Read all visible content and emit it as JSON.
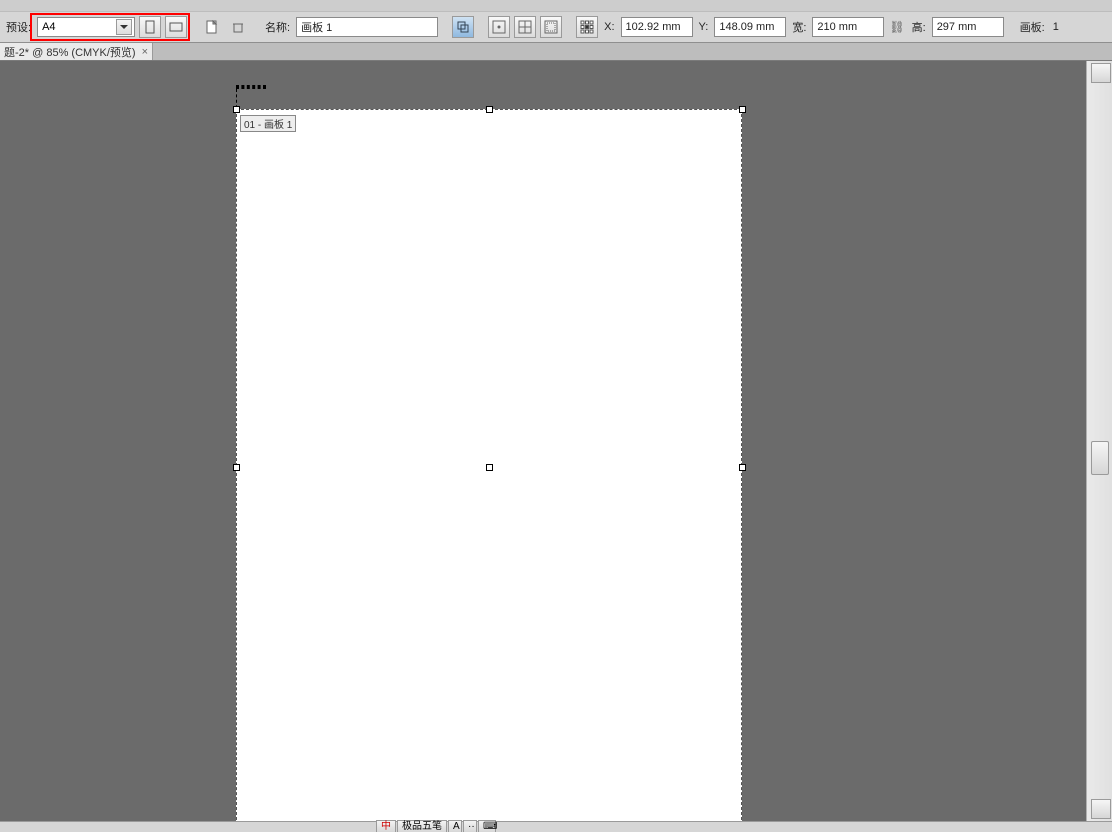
{
  "toolbar": {
    "preset_label": "预设:",
    "preset_value": "A4",
    "name_label": "名称:",
    "name_value": "画板 1",
    "x_label": "X:",
    "x_value": "102.92 mm",
    "y_label": "Y:",
    "y_value": "148.09 mm",
    "w_label": "宽:",
    "w_value": "210 mm",
    "h_label": "高:",
    "h_value": "297 mm",
    "artboard_label": "画板:",
    "artboard_count": "1"
  },
  "tab": {
    "title": "题-2* @ 85% (CMYK/预览)"
  },
  "artboard": {
    "label": "01 - 画板 1"
  },
  "taskbar": {
    "item1": "极品五笔",
    "item2": ""
  }
}
